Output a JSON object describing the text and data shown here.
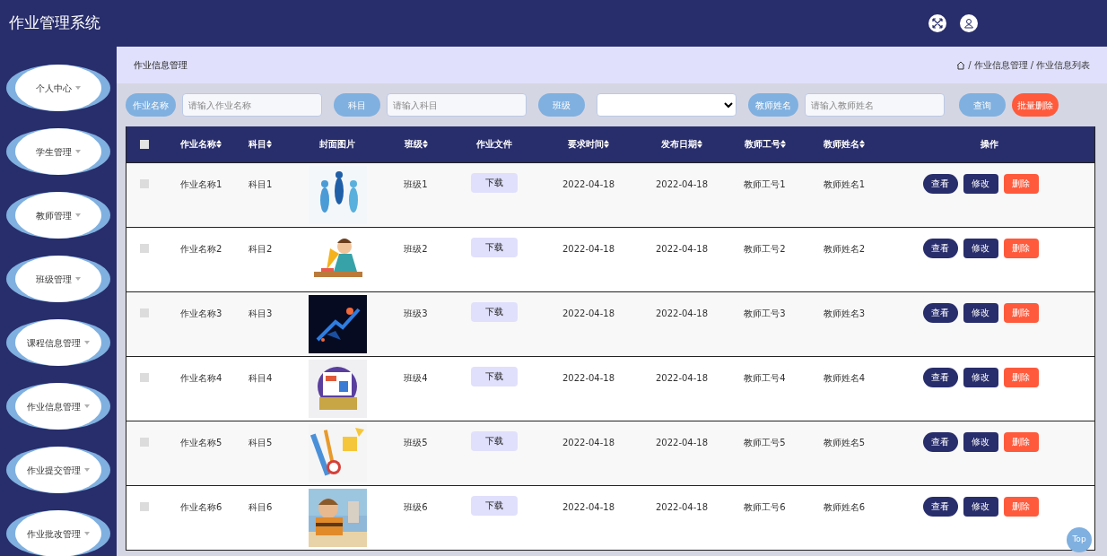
{
  "app": {
    "title": "作业管理系统"
  },
  "sidebar": {
    "items": [
      {
        "label": "个人中心"
      },
      {
        "label": "学生管理"
      },
      {
        "label": "教师管理"
      },
      {
        "label": "班级管理"
      },
      {
        "label": "课程信息管理"
      },
      {
        "label": "作业信息管理"
      },
      {
        "label": "作业提交管理"
      },
      {
        "label": "作业批改管理"
      }
    ]
  },
  "breadcrumb": {
    "page_title": "作业信息管理",
    "separator": "/",
    "path": [
      "作业信息管理",
      "作业信息列表"
    ]
  },
  "search": {
    "fields": [
      {
        "kind": "text",
        "label": "作业名称",
        "placeholder": "请输入作业名称"
      },
      {
        "kind": "text",
        "label": "科目",
        "placeholder": "请输入科目"
      },
      {
        "kind": "select",
        "label": "班级"
      },
      {
        "kind": "text",
        "label": "教师姓名",
        "placeholder": "请输入教师姓名"
      }
    ],
    "buttons": [
      {
        "kind": "query",
        "label": "查询"
      },
      {
        "kind": "danger",
        "label": "批量删除"
      }
    ]
  },
  "table": {
    "select_all": {
      "checked": false
    },
    "columns": [
      {
        "label": "作业名称",
        "sortable": true
      },
      {
        "label": "科目",
        "sortable": true
      },
      {
        "label": "封面图片",
        "sortable": false
      },
      {
        "label": "班级",
        "sortable": true
      },
      {
        "label": "作业文件",
        "sortable": false
      },
      {
        "label": "要求时间",
        "sortable": true
      },
      {
        "label": "发布日期",
        "sortable": true
      },
      {
        "label": "教师工号",
        "sortable": true
      },
      {
        "label": "教师姓名",
        "sortable": true
      },
      {
        "label": "操作",
        "sortable": false
      }
    ],
    "rows": [
      {
        "checked": false,
        "name": "作业名称1",
        "subject": "科目1",
        "cover": {
          "kind": "picture"
        },
        "class": "班级1",
        "file": "下载",
        "due": "2022-04-18",
        "published": "2022-04-18",
        "teacher_id": "教师工号1",
        "teacher_name": "教师姓名1",
        "actions": [
          {
            "kind": "view",
            "label": "查看"
          },
          {
            "kind": "edit",
            "label": "修改"
          },
          {
            "kind": "delete",
            "label": "删除"
          }
        ]
      },
      {
        "checked": false,
        "name": "作业名称2",
        "subject": "科目2",
        "cover": {
          "kind": "picture"
        },
        "class": "班级2",
        "file": "下载",
        "due": "2022-04-18",
        "published": "2022-04-18",
        "teacher_id": "教师工号2",
        "teacher_name": "教师姓名2",
        "actions": [
          {
            "kind": "view",
            "label": "查看"
          },
          {
            "kind": "edit",
            "label": "修改"
          },
          {
            "kind": "delete",
            "label": "删除"
          }
        ]
      },
      {
        "checked": false,
        "name": "作业名称3",
        "subject": "科目3",
        "cover": {
          "kind": "picture"
        },
        "class": "班级3",
        "file": "下载",
        "due": "2022-04-18",
        "published": "2022-04-18",
        "teacher_id": "教师工号3",
        "teacher_name": "教师姓名3",
        "actions": [
          {
            "kind": "view",
            "label": "查看"
          },
          {
            "kind": "edit",
            "label": "修改"
          },
          {
            "kind": "delete",
            "label": "删除"
          }
        ]
      },
      {
        "checked": false,
        "name": "作业名称4",
        "subject": "科目4",
        "cover": {
          "kind": "picture"
        },
        "class": "班级4",
        "file": "下载",
        "due": "2022-04-18",
        "published": "2022-04-18",
        "teacher_id": "教师工号4",
        "teacher_name": "教师姓名4",
        "actions": [
          {
            "kind": "view",
            "label": "查看"
          },
          {
            "kind": "edit",
            "label": "修改"
          },
          {
            "kind": "delete",
            "label": "删除"
          }
        ]
      },
      {
        "checked": false,
        "name": "作业名称5",
        "subject": "科目5",
        "cover": {
          "kind": "picture"
        },
        "class": "班级5",
        "file": "下载",
        "due": "2022-04-18",
        "published": "2022-04-18",
        "teacher_id": "教师工号5",
        "teacher_name": "教师姓名5",
        "actions": [
          {
            "kind": "view",
            "label": "查看"
          },
          {
            "kind": "edit",
            "label": "修改"
          },
          {
            "kind": "delete",
            "label": "删除"
          }
        ]
      },
      {
        "checked": false,
        "name": "作业名称6",
        "subject": "科目6",
        "cover": {
          "kind": "picture"
        },
        "class": "班级6",
        "file": "下载",
        "due": "2022-04-18",
        "published": "2022-04-18",
        "teacher_id": "教师工号6",
        "teacher_name": "教师姓名6",
        "actions": [
          {
            "kind": "view",
            "label": "查看"
          },
          {
            "kind": "edit",
            "label": "修改"
          },
          {
            "kind": "delete",
            "label": "删除"
          }
        ]
      }
    ]
  },
  "top_button": "Top"
}
